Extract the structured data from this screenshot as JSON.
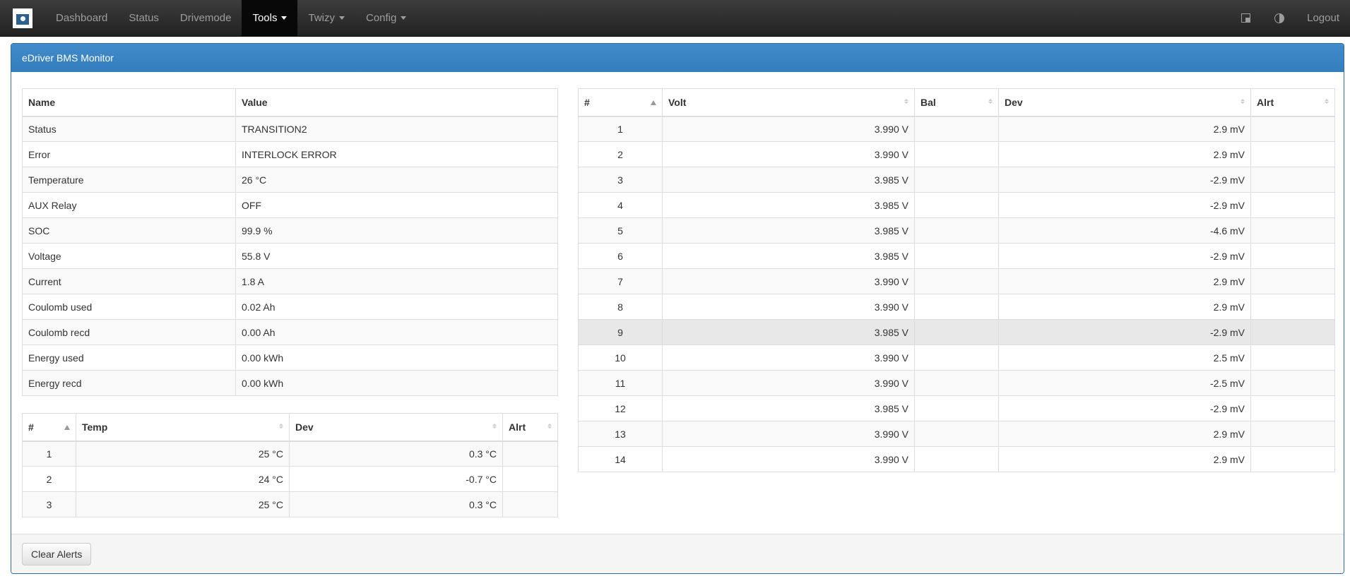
{
  "nav": {
    "items": [
      {
        "label": "Dashboard"
      },
      {
        "label": "Status"
      },
      {
        "label": "Drivemode"
      },
      {
        "label": "Tools",
        "dropdown": true,
        "active": true
      },
      {
        "label": "Twizy",
        "dropdown": true
      },
      {
        "label": "Config",
        "dropdown": true
      }
    ],
    "logout": "Logout"
  },
  "panel": {
    "title": "eDriver BMS Monitor",
    "clear_alerts": "Clear Alerts"
  },
  "info_table": {
    "headers": [
      "Name",
      "Value"
    ],
    "rows": [
      [
        "Status",
        "TRANSITION2"
      ],
      [
        "Error",
        "INTERLOCK ERROR"
      ],
      [
        "Temperature",
        "26 °C"
      ],
      [
        "AUX Relay",
        "OFF"
      ],
      [
        "SOC",
        "99.9 %"
      ],
      [
        "Voltage",
        "55.8 V"
      ],
      [
        "Current",
        "1.8 A"
      ],
      [
        "Coulomb used",
        "0.02 Ah"
      ],
      [
        "Coulomb recd",
        "0.00 Ah"
      ],
      [
        "Energy used",
        "0.00 kWh"
      ],
      [
        "Energy recd",
        "0.00 kWh"
      ]
    ]
  },
  "temp_table": {
    "headers": [
      "#",
      "Temp",
      "Dev",
      "Alrt"
    ],
    "rows": [
      [
        "1",
        "25 °C",
        "0.3 °C",
        ""
      ],
      [
        "2",
        "24 °C",
        "-0.7 °C",
        ""
      ],
      [
        "3",
        "25 °C",
        "0.3 °C",
        ""
      ]
    ]
  },
  "cell_table": {
    "headers": [
      "#",
      "Volt",
      "Bal",
      "Dev",
      "Alrt"
    ],
    "rows": [
      [
        "1",
        "3.990 V",
        "",
        "2.9 mV",
        ""
      ],
      [
        "2",
        "3.990 V",
        "",
        "2.9 mV",
        ""
      ],
      [
        "3",
        "3.985 V",
        "",
        "-2.9 mV",
        ""
      ],
      [
        "4",
        "3.985 V",
        "",
        "-2.9 mV",
        ""
      ],
      [
        "5",
        "3.985 V",
        "",
        "-4.6 mV",
        ""
      ],
      [
        "6",
        "3.985 V",
        "",
        "-2.9 mV",
        ""
      ],
      [
        "7",
        "3.990 V",
        "",
        "2.9 mV",
        ""
      ],
      [
        "8",
        "3.990 V",
        "",
        "2.9 mV",
        ""
      ],
      [
        "9",
        "3.985 V",
        "",
        "-2.9 mV",
        ""
      ],
      [
        "10",
        "3.990 V",
        "",
        "2.5 mV",
        ""
      ],
      [
        "11",
        "3.990 V",
        "",
        "-2.5 mV",
        ""
      ],
      [
        "12",
        "3.985 V",
        "",
        "-2.9 mV",
        ""
      ],
      [
        "13",
        "3.990 V",
        "",
        "2.9 mV",
        ""
      ],
      [
        "14",
        "3.990 V",
        "",
        "2.9 mV",
        ""
      ]
    ],
    "highlighted_row": "9"
  },
  "icons": {
    "window": "window-icon",
    "contrast": "contrast-icon"
  },
  "colors": {
    "navbar": "#222222",
    "panel_heading": "#428bca",
    "active_nav": "#080808"
  }
}
